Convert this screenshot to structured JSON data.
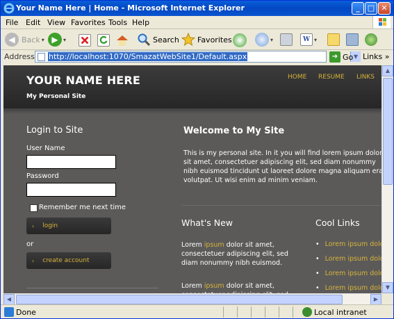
{
  "window": {
    "title": "Your Name Here | Home - Microsoft Internet Explorer"
  },
  "menu": [
    "File",
    "Edit",
    "View",
    "Favorites",
    "Tools",
    "Help"
  ],
  "toolbar": {
    "back": "Back",
    "search": "Search",
    "favorites": "Favorites"
  },
  "address": {
    "label": "Address",
    "url": "http://localhost:1070/SmazatWebSite1/Default.aspx",
    "go": "Go",
    "links": "Links"
  },
  "site": {
    "title": "YOUR NAME HERE",
    "subtitle": "My Personal Site",
    "nav": [
      "HOME",
      "RESUME",
      "LINKS"
    ]
  },
  "login": {
    "title": "Login to Site",
    "username_label": "User Name",
    "password_label": "Password",
    "remember_label": "Remember me next time",
    "login_button": "login",
    "or": "or",
    "create_button": "create account"
  },
  "welcome": {
    "title": "Welcome to My Site",
    "text": "This is my personal site. In it you will find lorem ipsum dolor sit amet, consectetuer adipiscing elit, sed diam nonummy nibh euismod tincidunt ut laoreet dolore magna aliquam erat volutpat. Ut wisi enim ad minim veniam."
  },
  "whats_new": {
    "title": "What's New",
    "items": [
      {
        "highlight": "ipsum",
        "lead": "Lorem ",
        "text": " dolor sit amet, consectetuer adipiscing elit, sed diam nonummy nibh euismod."
      },
      {
        "highlight": "ipsum",
        "lead": "Lorem ",
        "text": " dolor sit amet, consectetuer adipiscing elit, sed"
      }
    ]
  },
  "cool_links": {
    "title": "Cool Links",
    "items": [
      "Lorem ipsum dolor",
      "Lorem ipsum dolor",
      "Lorem ipsum dolor",
      "Lorem ipsum dolor"
    ]
  },
  "status": {
    "text": "Done",
    "zone": "Local intranet"
  },
  "colors": {
    "accent_gold": "#d8b339",
    "page_bg": "#5b5a59",
    "header_bg": "#2c2c2c",
    "xp_blue": "#0a5fd8"
  }
}
